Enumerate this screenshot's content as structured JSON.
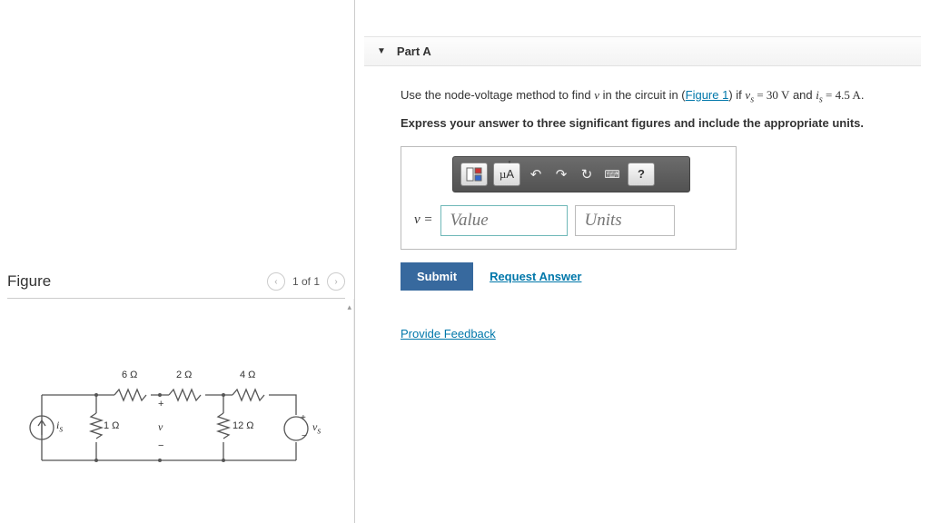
{
  "figure": {
    "title": "Figure",
    "pager": "1 of 1",
    "labels": {
      "r6": "6 Ω",
      "r2": "2 Ω",
      "r4": "4 Ω",
      "r1": "1 Ω",
      "r12": "12 Ω",
      "is": "i",
      "is_sub": "s",
      "v": "v",
      "vs": "v",
      "vs_sub": "s",
      "plus": "+",
      "minus": "−"
    }
  },
  "part": {
    "header": "Part A",
    "q_pre": "Use the node-voltage method to find ",
    "q_var": "v",
    "q_mid": " in the circuit in (",
    "q_link": "Figure 1",
    "q_post1": ") if ",
    "q_vs": "v",
    "q_vs_sub": "s",
    "q_eq1": " = 30 ",
    "q_unitV": "V",
    "q_and": " and ",
    "q_is": "i",
    "q_is_sub": "s",
    "q_eq2": " = 4.5 ",
    "q_unitA": "A",
    "q_end": ".",
    "instruct": "Express your answer to three significant figures and include the appropriate units.",
    "toolbar": {
      "templates": "⬜⬛",
      "units": "µÅ",
      "undo": "↶",
      "redo": "↷",
      "reset": "↻",
      "keyboard": "⌨",
      "help": "?"
    },
    "eq_label": "v =",
    "value_ph": "Value",
    "units_ph": "Units",
    "submit": "Submit",
    "request": "Request Answer",
    "feedback": "Provide Feedback"
  }
}
